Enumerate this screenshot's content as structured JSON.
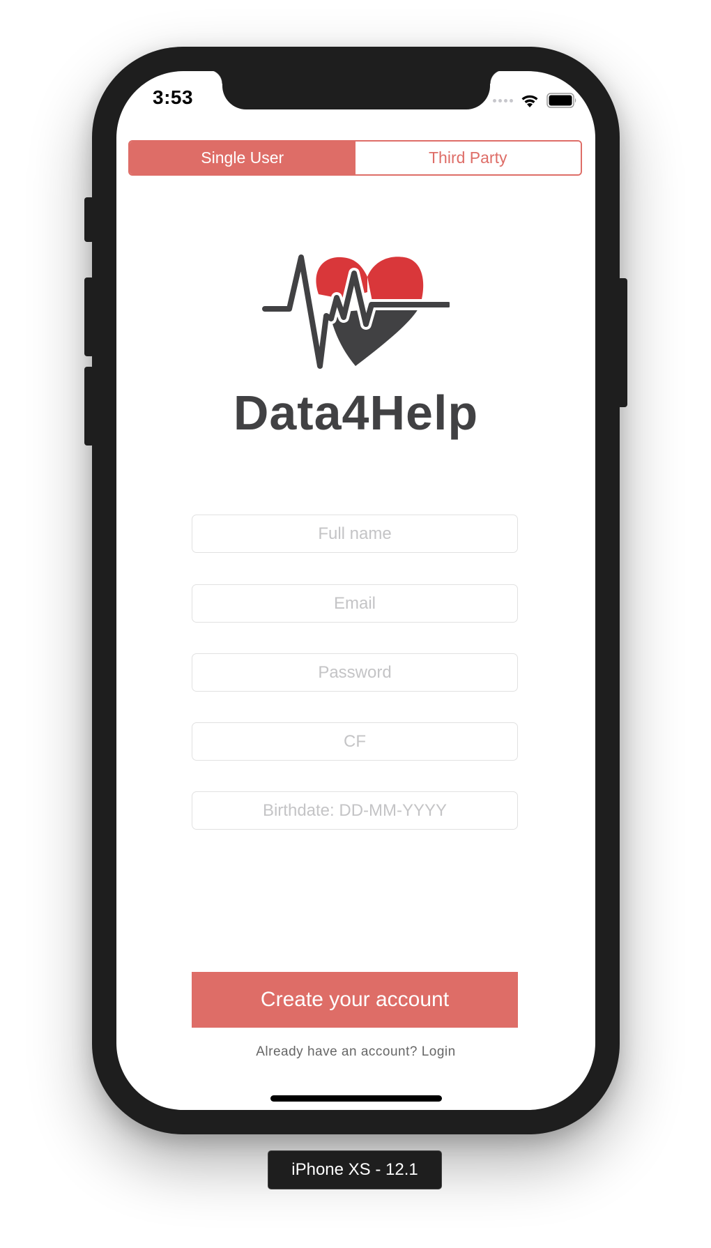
{
  "status_bar": {
    "time": "3:53"
  },
  "segmented_control": {
    "options": [
      {
        "label": "Single User",
        "selected": true
      },
      {
        "label": "Third Party",
        "selected": false
      }
    ]
  },
  "logo": {
    "brand_name": "Data4Help",
    "icon": "heartbeat-heart-icon"
  },
  "form": {
    "full_name": {
      "value": "",
      "placeholder": "Full name"
    },
    "email": {
      "value": "",
      "placeholder": "Email"
    },
    "password": {
      "value": "",
      "placeholder": "Password"
    },
    "cf": {
      "value": "",
      "placeholder": "CF"
    },
    "birthdate": {
      "value": "",
      "placeholder": "Birthdate: DD-MM-YYYY"
    }
  },
  "actions": {
    "create_account_label": "Create your account",
    "login_prompt": "Already have an account? Login"
  },
  "simulator": {
    "device_label": "iPhone XS - 12.1"
  },
  "colors": {
    "accent": "#de6d67",
    "heart_red": "#d9373a",
    "dark_gray": "#414143",
    "device_frame": "#1e1e1e"
  }
}
